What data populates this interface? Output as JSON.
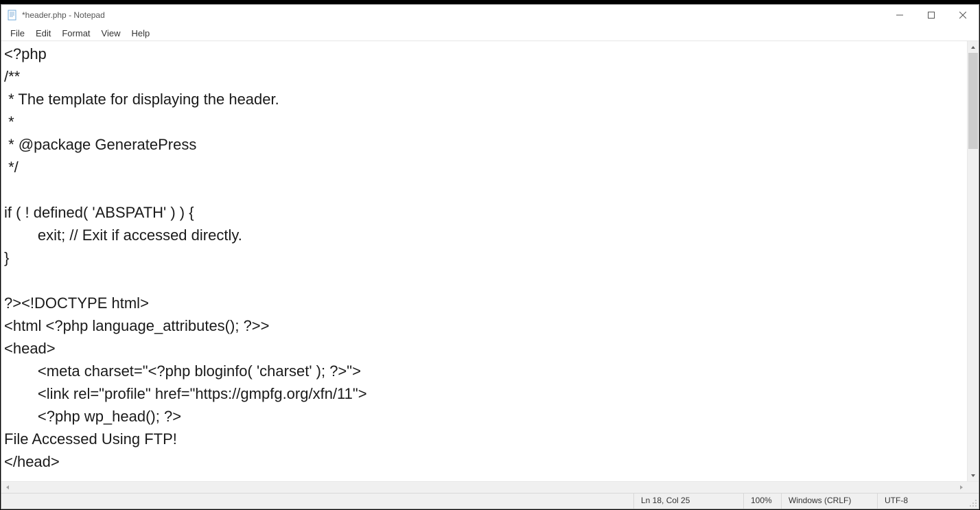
{
  "window": {
    "title": "*header.php - Notepad"
  },
  "menu": {
    "file": "File",
    "edit": "Edit",
    "format": "Format",
    "view": "View",
    "help": "Help"
  },
  "editor": {
    "content": "<?php\n/**\n * The template for displaying the header.\n *\n * @package GeneratePress\n */\n\nif ( ! defined( 'ABSPATH' ) ) {\n\texit; // Exit if accessed directly.\n}\n\n?><!DOCTYPE html>\n<html <?php language_attributes(); ?>>\n<head>\n\t<meta charset=\"<?php bloginfo( 'charset' ); ?>\">\n\t<link rel=\"profile\" href=\"https://gmpfg.org/xfn/11\">\n\t<?php wp_head(); ?>\nFile Accessed Using FTP!\n</head>"
  },
  "status": {
    "position": "Ln 18, Col 25",
    "zoom": "100%",
    "eol": "Windows (CRLF)",
    "encoding": "UTF-8"
  }
}
